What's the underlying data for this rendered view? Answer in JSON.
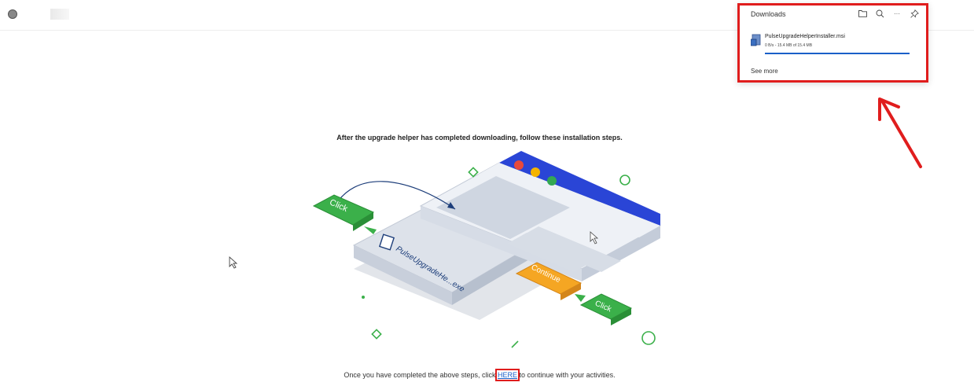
{
  "downloads": {
    "title": "Downloads",
    "tools": [
      "folder-icon",
      "search-icon",
      "more-icon",
      "pin-icon"
    ],
    "more_label": "···",
    "file": {
      "name": "PulseUpgradeHelperInstaller.msi",
      "status": "0 B/s - 15.4 MB of 15.4 MB",
      "progress": 1.0
    },
    "see_more": "See more"
  },
  "main": {
    "heading": "After the upgrade helper has completed downloading, follow these installation steps.",
    "illustration": {
      "click_label_left": "Click",
      "file_label": "PulseUpgradeHe...exe",
      "continue_label": "Continue",
      "click_label_right": "Click"
    },
    "footer_before": "Once you have completed the above steps, click ",
    "footer_link": "HERE",
    "footer_after": " to continue with your activities."
  },
  "colors": {
    "highlight_red": "#e01d1d",
    "progress_blue": "#1a5fc8",
    "browser_blue": "#2a45d6",
    "click_green": "#3bb04a",
    "continue_orange": "#f5a623"
  }
}
